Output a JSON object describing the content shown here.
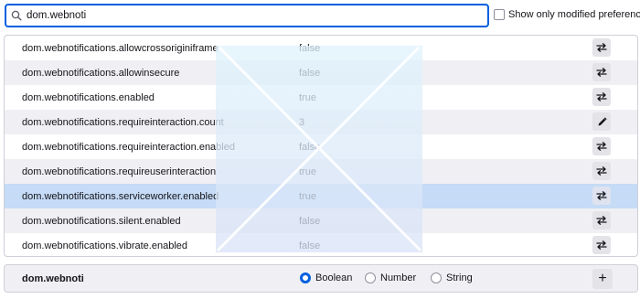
{
  "search": {
    "value": "dom.webnoti",
    "icon": "search-icon"
  },
  "filter": {
    "show_modified_label": "Show only modified preferences",
    "checked": false
  },
  "prefs": [
    {
      "name": "dom.webnotifications.allowcrossoriginiframe",
      "value": "false",
      "action_icon": "toggle-icon"
    },
    {
      "name": "dom.webnotifications.allowinsecure",
      "value": "false",
      "action_icon": "toggle-icon"
    },
    {
      "name": "dom.webnotifications.enabled",
      "value": "true",
      "action_icon": "toggle-icon"
    },
    {
      "name": "dom.webnotifications.requireinteraction.count",
      "value": "3",
      "action_icon": "edit-icon"
    },
    {
      "name": "dom.webnotifications.requireinteraction.enabled",
      "value": "false",
      "action_icon": "toggle-icon"
    },
    {
      "name": "dom.webnotifications.requireuserinteraction",
      "value": "true",
      "action_icon": "toggle-icon"
    },
    {
      "name": "dom.webnotifications.serviceworker.enabled",
      "value": "true",
      "action_icon": "toggle-icon",
      "selected": true
    },
    {
      "name": "dom.webnotifications.silent.enabled",
      "value": "false",
      "action_icon": "toggle-icon"
    },
    {
      "name": "dom.webnotifications.vibrate.enabled",
      "value": "false",
      "action_icon": "toggle-icon"
    }
  ],
  "new_pref": {
    "name": "dom.webnoti",
    "types": [
      {
        "label": "Boolean",
        "checked": true
      },
      {
        "label": "Number",
        "checked": false
      },
      {
        "label": "String",
        "checked": false
      }
    ],
    "add_icon": "plus-icon",
    "add_label": "+"
  },
  "colors": {
    "accent": "#0060df",
    "row_alt": "#f0f0f4",
    "row_selected": "#c5dbf6"
  }
}
